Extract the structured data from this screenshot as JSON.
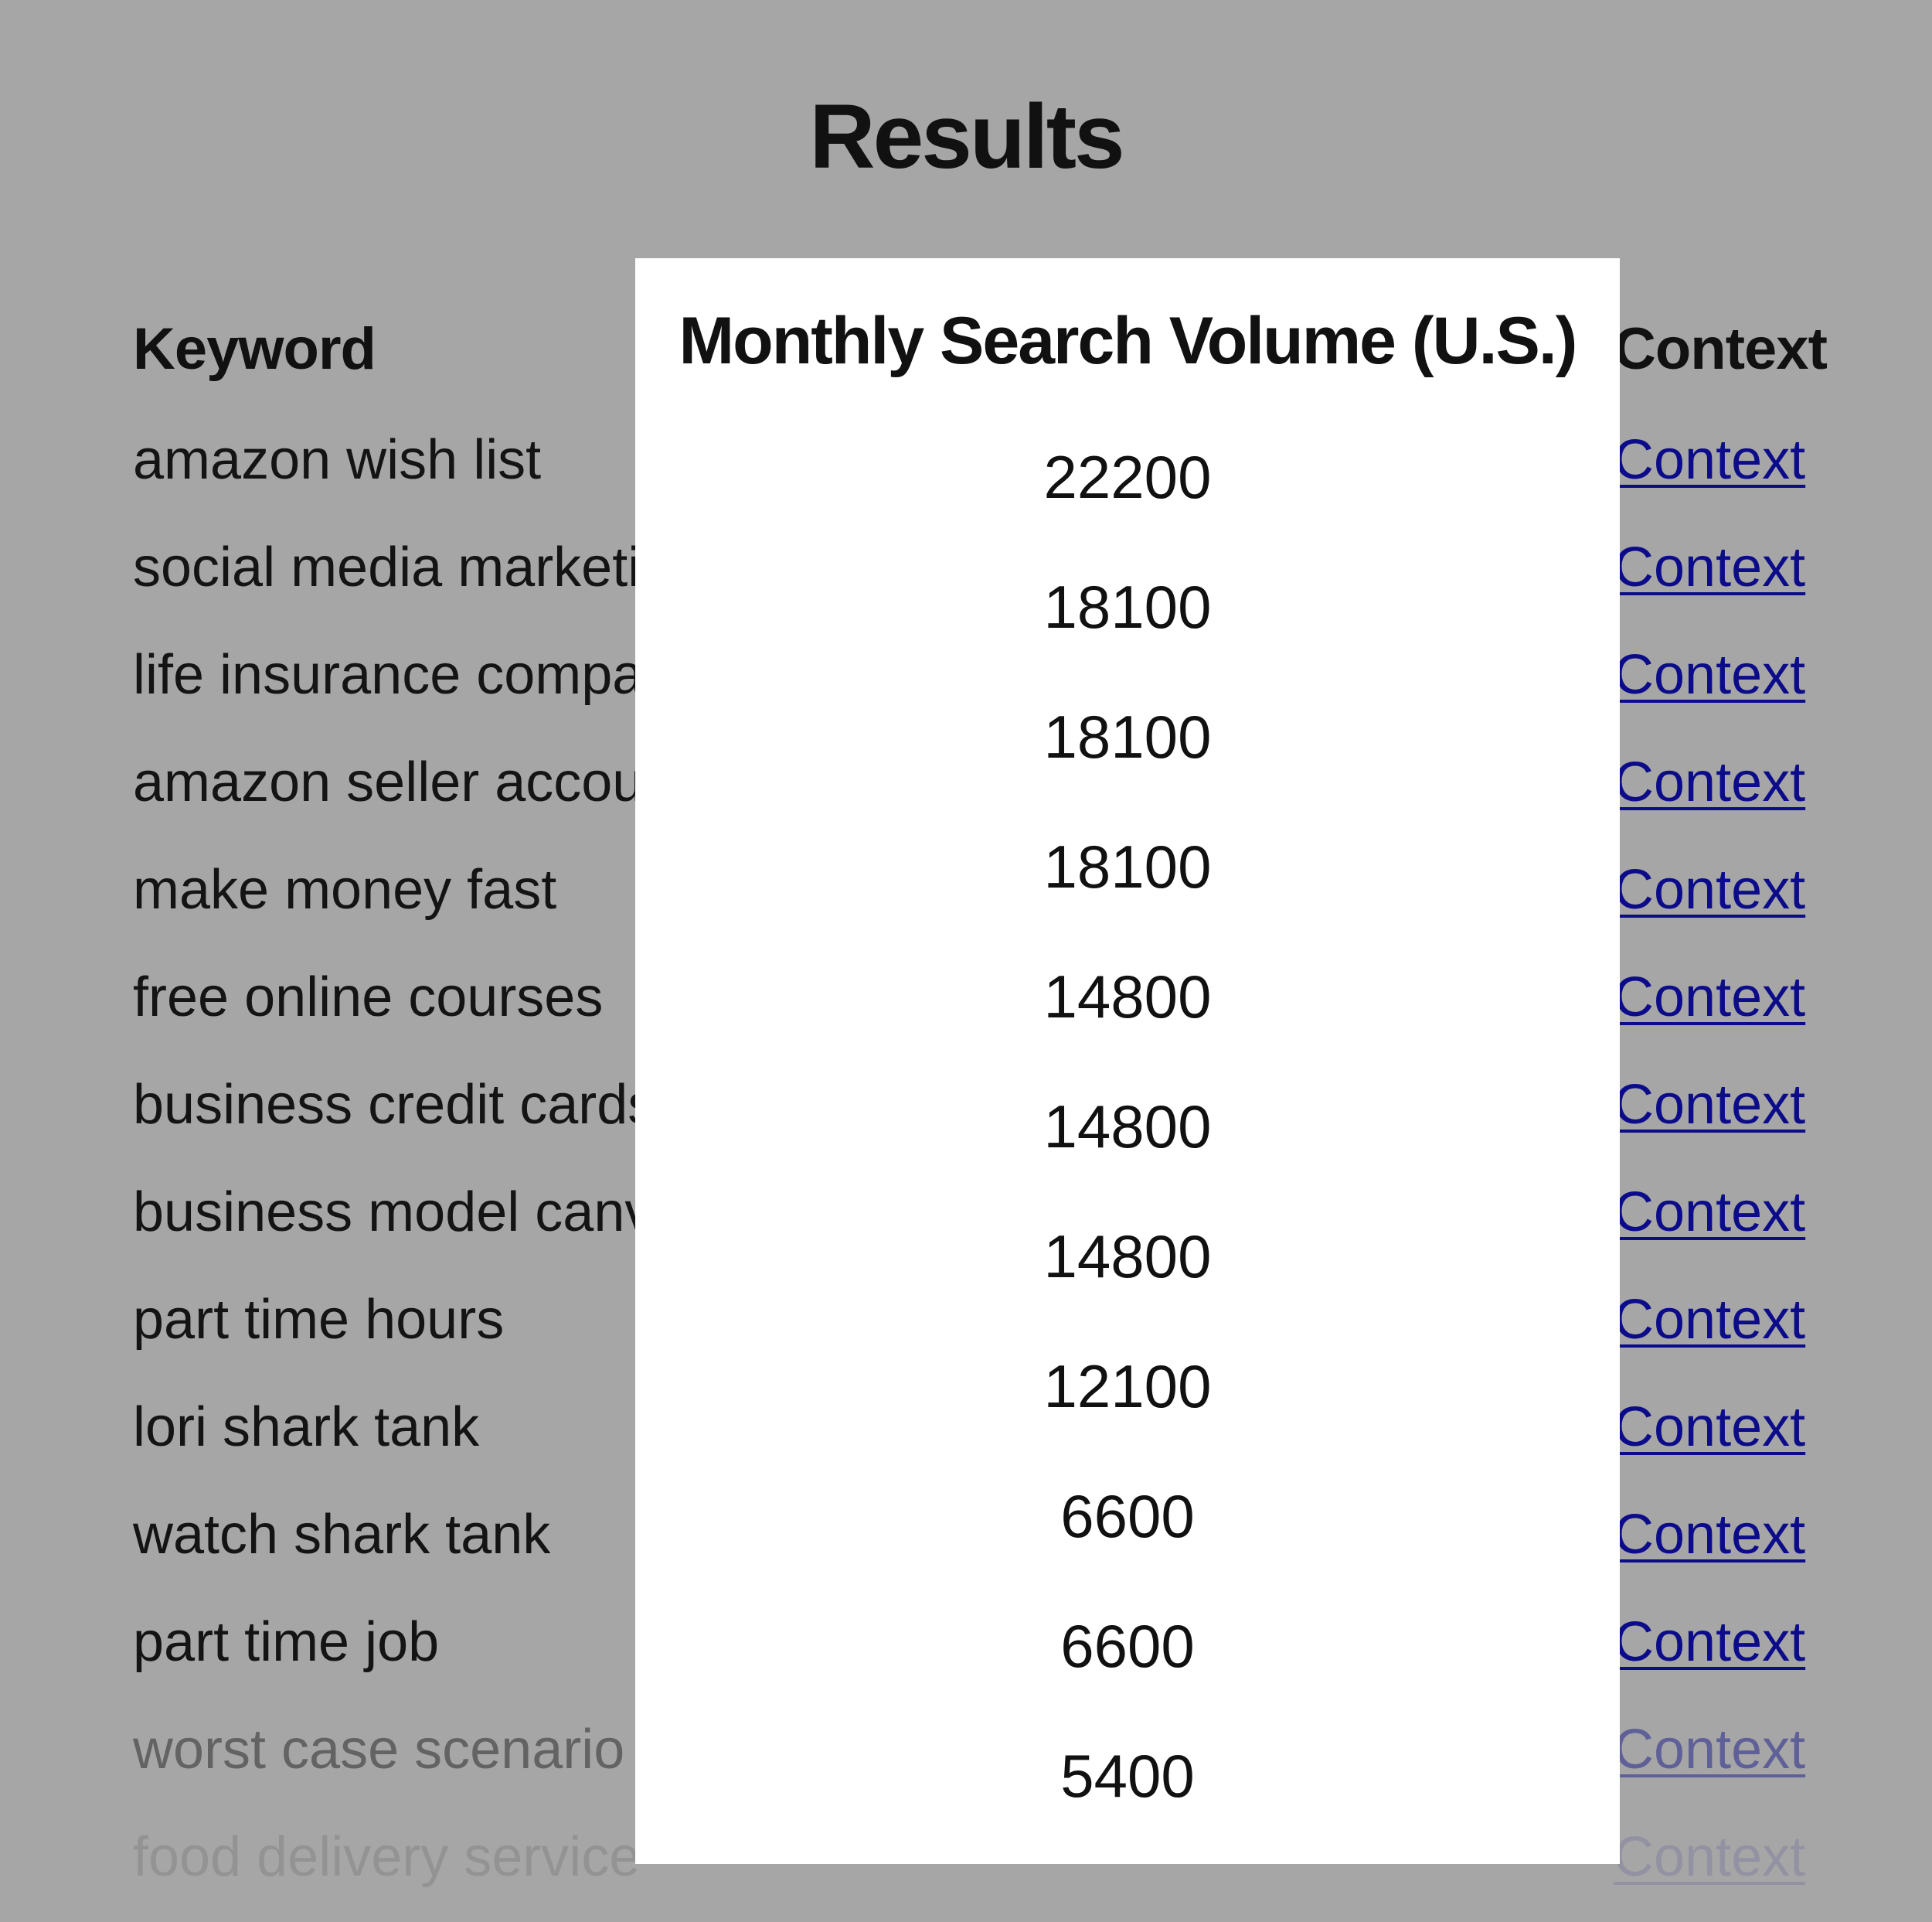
{
  "page": {
    "title": "Results"
  },
  "table": {
    "columns": {
      "keyword": "Keyword",
      "volume": "Monthly Search Volume (U.S.)",
      "context": "Context"
    },
    "keywords": [
      "amazon wish list",
      "social media marketi",
      "life insurance compa",
      "amazon seller accou",
      "make money fast",
      "free online courses",
      "business credit cards",
      "business model canv",
      "part time hours",
      "lori shark tank",
      "watch shark tank",
      "part time job",
      "worst case scenario",
      "food delivery service"
    ],
    "volumes": [
      "22200",
      "18100",
      "18100",
      "18100",
      "14800",
      "14800",
      "14800",
      "12100",
      "6600",
      "6600",
      "5400"
    ],
    "context_link_label": "Context",
    "colors": {
      "background": "#a6a6a6",
      "panel": "#ffffff",
      "link": "#0c0c8a",
      "text": "#141414"
    }
  }
}
